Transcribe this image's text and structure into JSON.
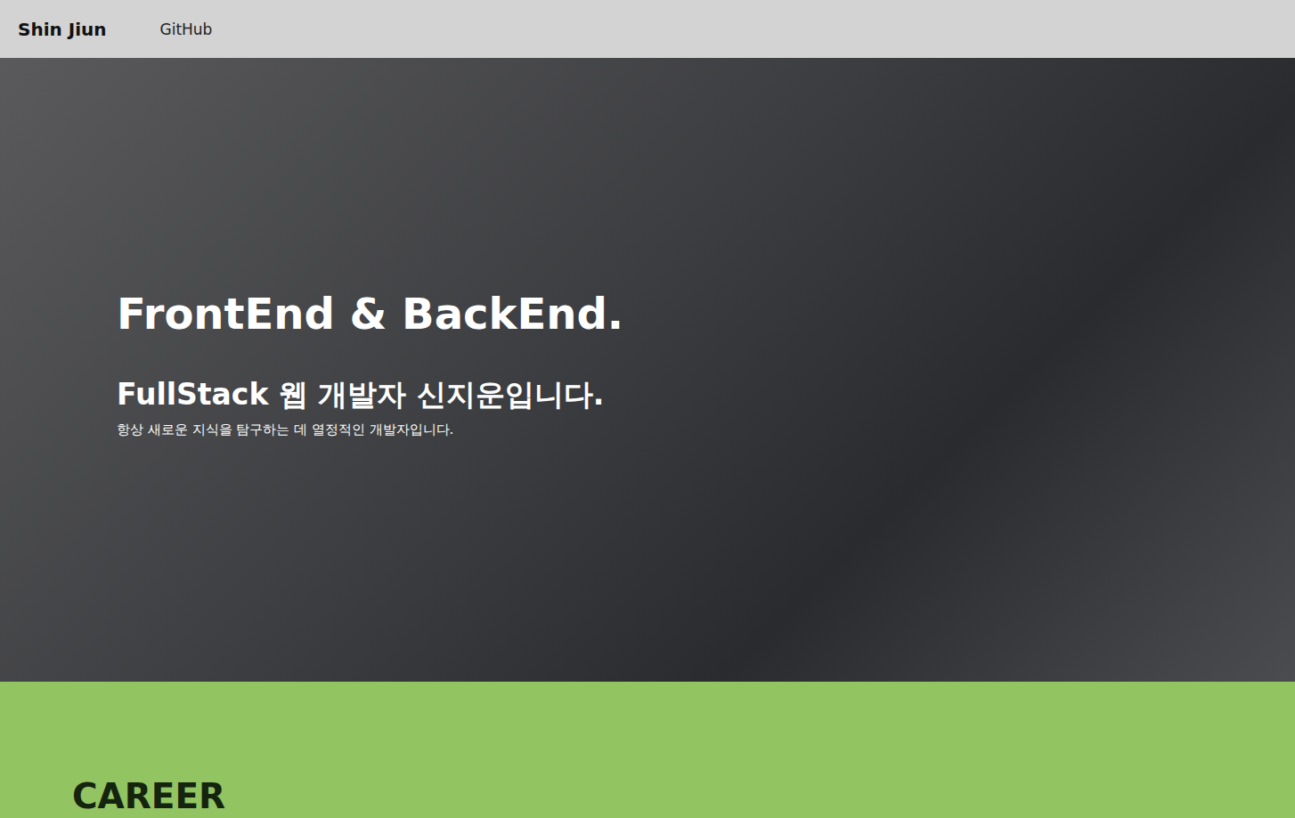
{
  "nav": {
    "brand": "Shin Jiun",
    "links": [
      {
        "label": "GitHub"
      }
    ]
  },
  "hero": {
    "title": "FrontEnd & BackEnd.",
    "subtitle": "FullStack 웹 개발자 신지운입니다.",
    "description": "항상 새로운 지식을 탐구하는 데 열정적인 개발자입니다."
  },
  "sections": [
    {
      "title": "CAREER"
    }
  ]
}
